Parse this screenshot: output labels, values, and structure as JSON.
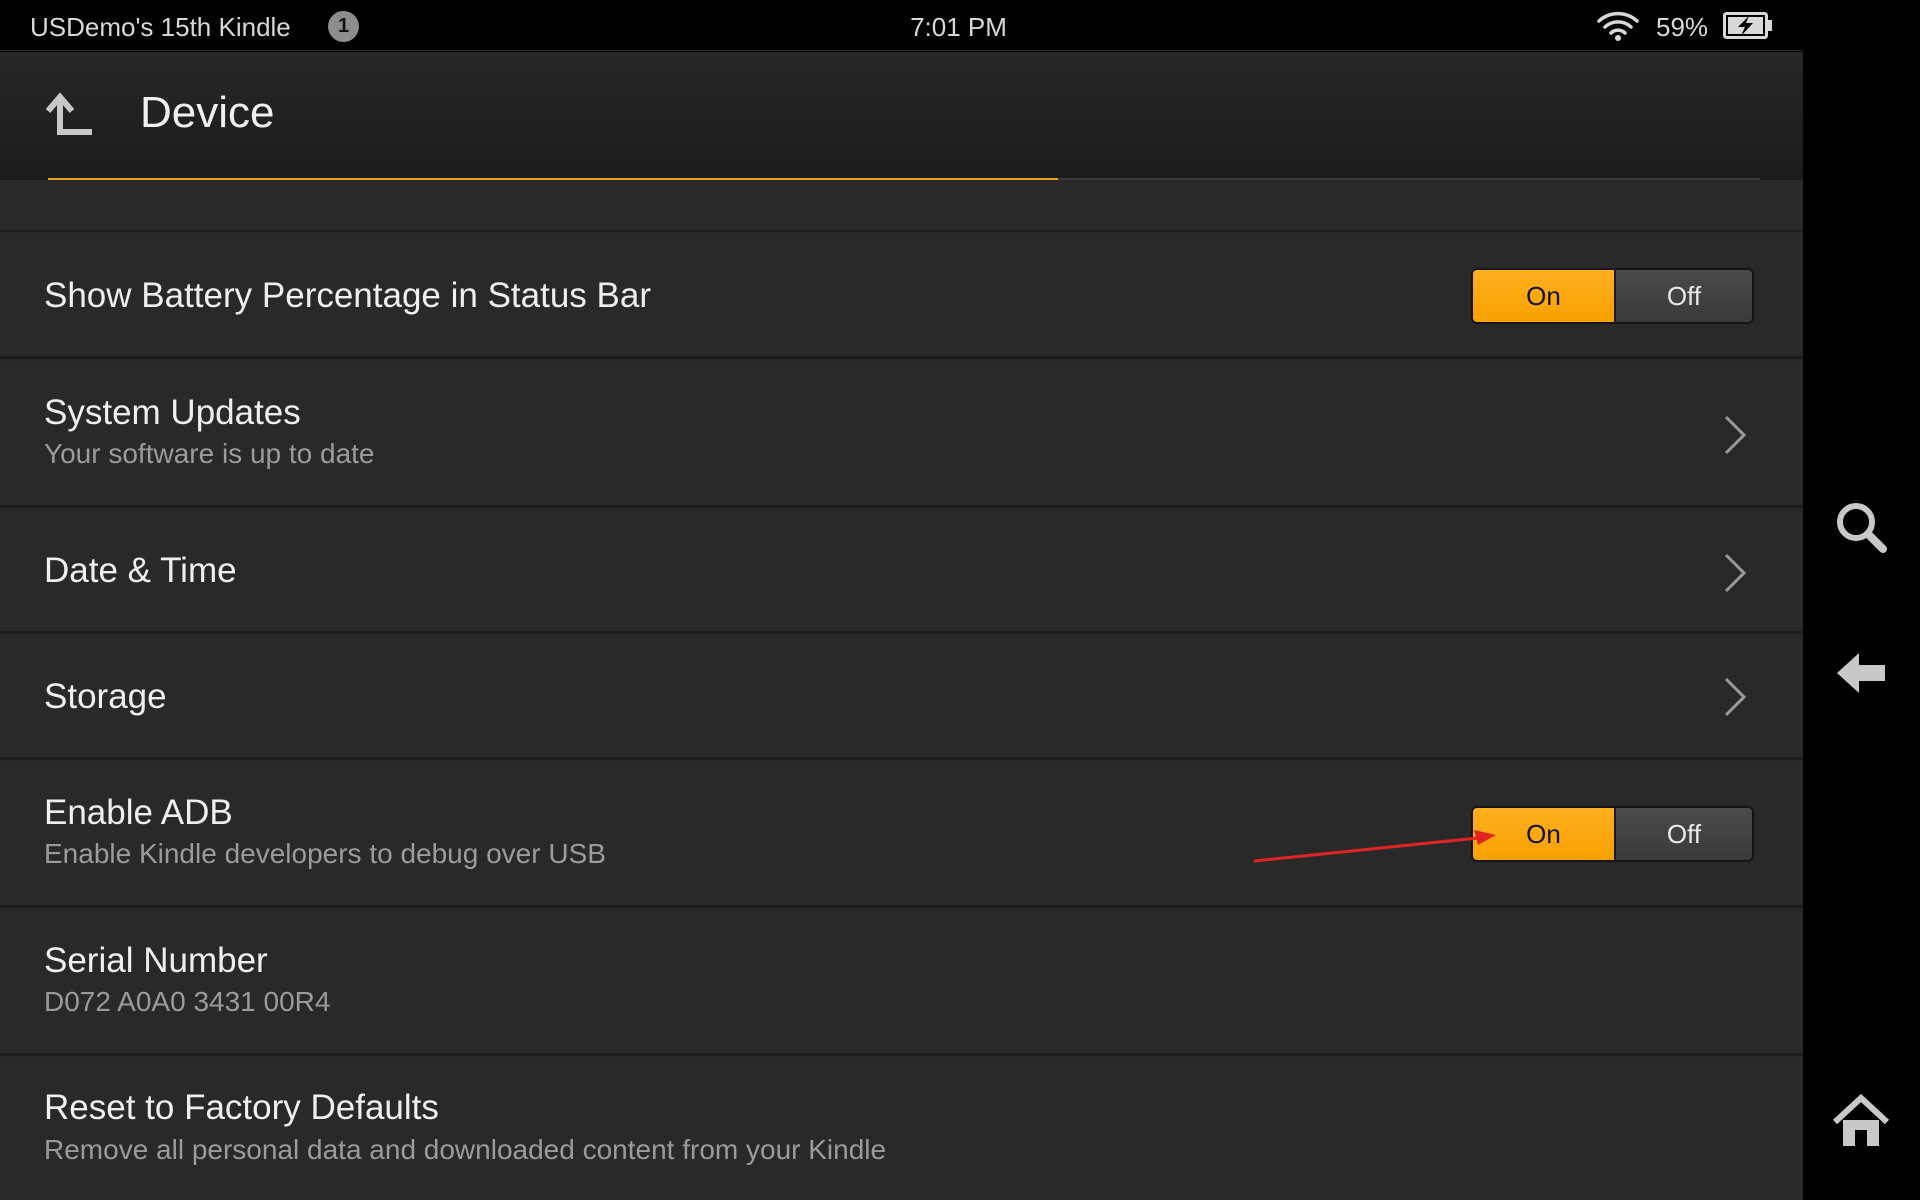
{
  "status_bar": {
    "device_name": "USDemo's 15th Kindle",
    "notification_count": "1",
    "time": "7:01 PM",
    "battery_percent": "59%",
    "wifi_icon": "wifi-icon",
    "battery_icon": "battery-charging-icon"
  },
  "header": {
    "title": "Device",
    "back_icon": "up-arrow-icon",
    "scroll_position": 0.59
  },
  "settings": [
    {
      "title": "Show Battery Percentage in Status Bar",
      "toggle": {
        "on_label": "On",
        "off_label": "Off",
        "selected": "On"
      }
    },
    {
      "title": "System Updates",
      "subtitle": "Your software is up to date",
      "icon": "chevron-right-icon"
    },
    {
      "title": "Date & Time",
      "icon": "chevron-right-icon"
    },
    {
      "title": "Storage",
      "icon": "chevron-right-icon"
    },
    {
      "title": "Enable ADB",
      "subtitle": "Enable Kindle developers to debug over USB",
      "toggle": {
        "on_label": "On",
        "off_label": "Off",
        "selected": "On"
      }
    },
    {
      "title": "Serial Number",
      "subtitle": "D072 A0A0 3431 00R4"
    },
    {
      "title": "Reset to Factory Defaults",
      "subtitle": "Remove all personal data and downloaded content from your Kindle"
    }
  ],
  "nav_bar": {
    "search_icon": "search-icon",
    "back_icon": "back-arrow-icon",
    "home_icon": "home-icon"
  },
  "colors": {
    "accent": "#f7a000",
    "annotation": "#e02424",
    "background": "#282828"
  }
}
